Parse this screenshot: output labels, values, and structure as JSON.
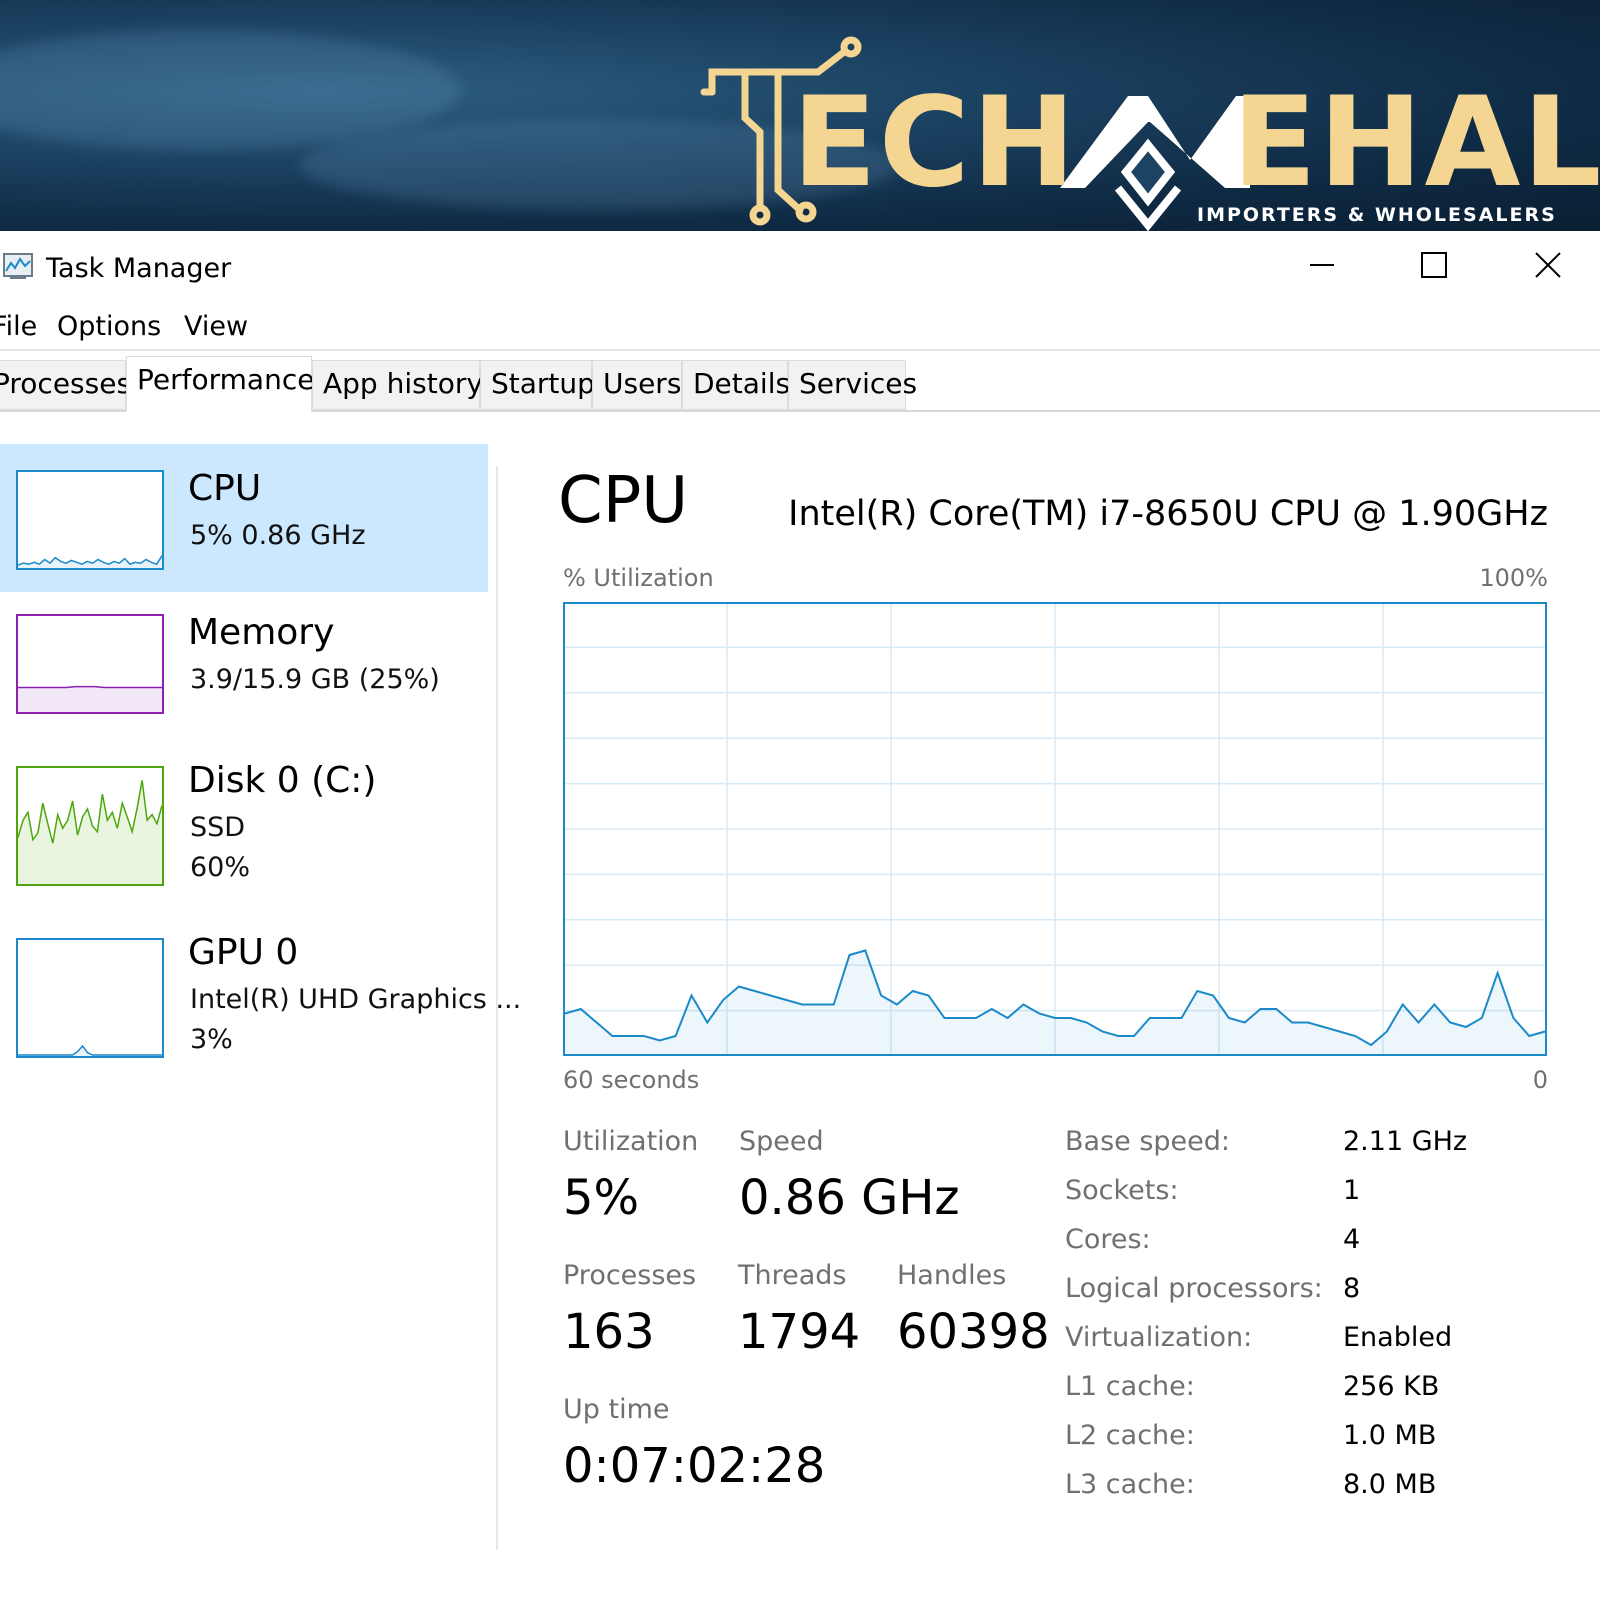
{
  "banner": {
    "brand_letters": [
      "ECH",
      "EHAL"
    ],
    "subtitle": "IMPORTERS & WHOLESALERS",
    "bg_color": "#1c4363",
    "accent_color": "#f5d592"
  },
  "window": {
    "title": "Task Manager",
    "icon": "task-manager-icon",
    "controls": [
      "minimize-icon",
      "maximize-icon",
      "close-icon"
    ]
  },
  "menu": [
    "File",
    "Options",
    "View"
  ],
  "tabs": [
    "Processes",
    "Performance",
    "App history",
    "Startup",
    "Users",
    "Details",
    "Services"
  ],
  "active_tab": "Performance",
  "sidebar": {
    "items": [
      {
        "name": "CPU",
        "line1": "5%  0.86 GHz",
        "line2": "",
        "color": "#1a8ac8",
        "selected": true
      },
      {
        "name": "Memory",
        "line1": "3.9/15.9 GB (25%)",
        "line2": "",
        "color": "#8b20b2",
        "selected": false
      },
      {
        "name": "Disk 0 (C:)",
        "line1": "SSD",
        "line2": "60%",
        "color": "#4da60c",
        "selected": false
      },
      {
        "name": "GPU 0",
        "line1": "Intel(R) UHD Graphics ...",
        "line2": "3%",
        "color": "#1a8ac8",
        "selected": false
      }
    ]
  },
  "main": {
    "title": "CPU",
    "model": "Intel(R) Core(TM) i7-8650U CPU @ 1.90GHz",
    "graph_label": "% Utilization",
    "graph_max": "100%",
    "time_label": "60 seconds",
    "time_end": "0",
    "utilization_label": "Utilization",
    "utilization_value": "5%",
    "speed_label": "Speed",
    "speed_value": "0.86 GHz",
    "processes_label": "Processes",
    "processes_value": "163",
    "threads_label": "Threads",
    "threads_value": "1794",
    "handles_label": "Handles",
    "handles_value": "60398",
    "uptime_label": "Up time",
    "uptime_value": "0:07:02:28",
    "specs": [
      {
        "key": "Base speed:",
        "value": "2.11 GHz"
      },
      {
        "key": "Sockets:",
        "value": "1"
      },
      {
        "key": "Cores:",
        "value": "4"
      },
      {
        "key": "Logical processors:",
        "value": "8"
      },
      {
        "key": "Virtualization:",
        "value": "Enabled"
      },
      {
        "key": "L1 cache:",
        "value": "256 KB"
      },
      {
        "key": "L2 cache:",
        "value": "1.0 MB"
      },
      {
        "key": "L3 cache:",
        "value": "8.0 MB"
      }
    ]
  },
  "chart_data": {
    "type": "area",
    "x_unit": "seconds",
    "xlim": [
      60,
      0
    ],
    "ylim": [
      0,
      100
    ],
    "grid": true,
    "color": "#1a8ac8",
    "series": [
      {
        "values": [
          9,
          10,
          7,
          4,
          4,
          4,
          3,
          4,
          13,
          7,
          12,
          15,
          14,
          13,
          12,
          11,
          11,
          11,
          22,
          23,
          13,
          11,
          14,
          13,
          8,
          8,
          8,
          10,
          8,
          11,
          9,
          8,
          8,
          7,
          5,
          4,
          4,
          8,
          8,
          8,
          14,
          13,
          8,
          7,
          10,
          10,
          7,
          7,
          6,
          5,
          4,
          2,
          5,
          11,
          7,
          11,
          7,
          6,
          8,
          18,
          8,
          4,
          5
        ]
      }
    ],
    "sparklines": {
      "cpu": [
        2,
        4,
        3,
        5,
        3,
        8,
        4,
        10,
        6,
        4,
        7,
        5,
        3,
        6,
        4,
        8,
        5,
        3,
        6,
        4,
        9,
        3,
        5,
        4,
        8,
        5,
        3,
        12
      ],
      "memory": [
        25,
        25,
        25,
        25,
        25,
        25,
        26,
        26,
        26,
        25,
        25,
        25,
        25,
        25,
        25,
        25
      ],
      "disk": [
        40,
        55,
        62,
        38,
        44,
        70,
        52,
        35,
        60,
        48,
        55,
        72,
        42,
        58,
        65,
        50,
        45,
        78,
        55,
        62,
        48,
        70,
        58,
        45,
        66,
        90,
        55,
        60,
        52,
        68
      ],
      "gpu": [
        0,
        0,
        0,
        0,
        0,
        0,
        0,
        0,
        0,
        0,
        0,
        0,
        3,
        8,
        2,
        0,
        0,
        0,
        0,
        0,
        0,
        0,
        0,
        0,
        0,
        0,
        0,
        0,
        0,
        0
      ]
    }
  }
}
